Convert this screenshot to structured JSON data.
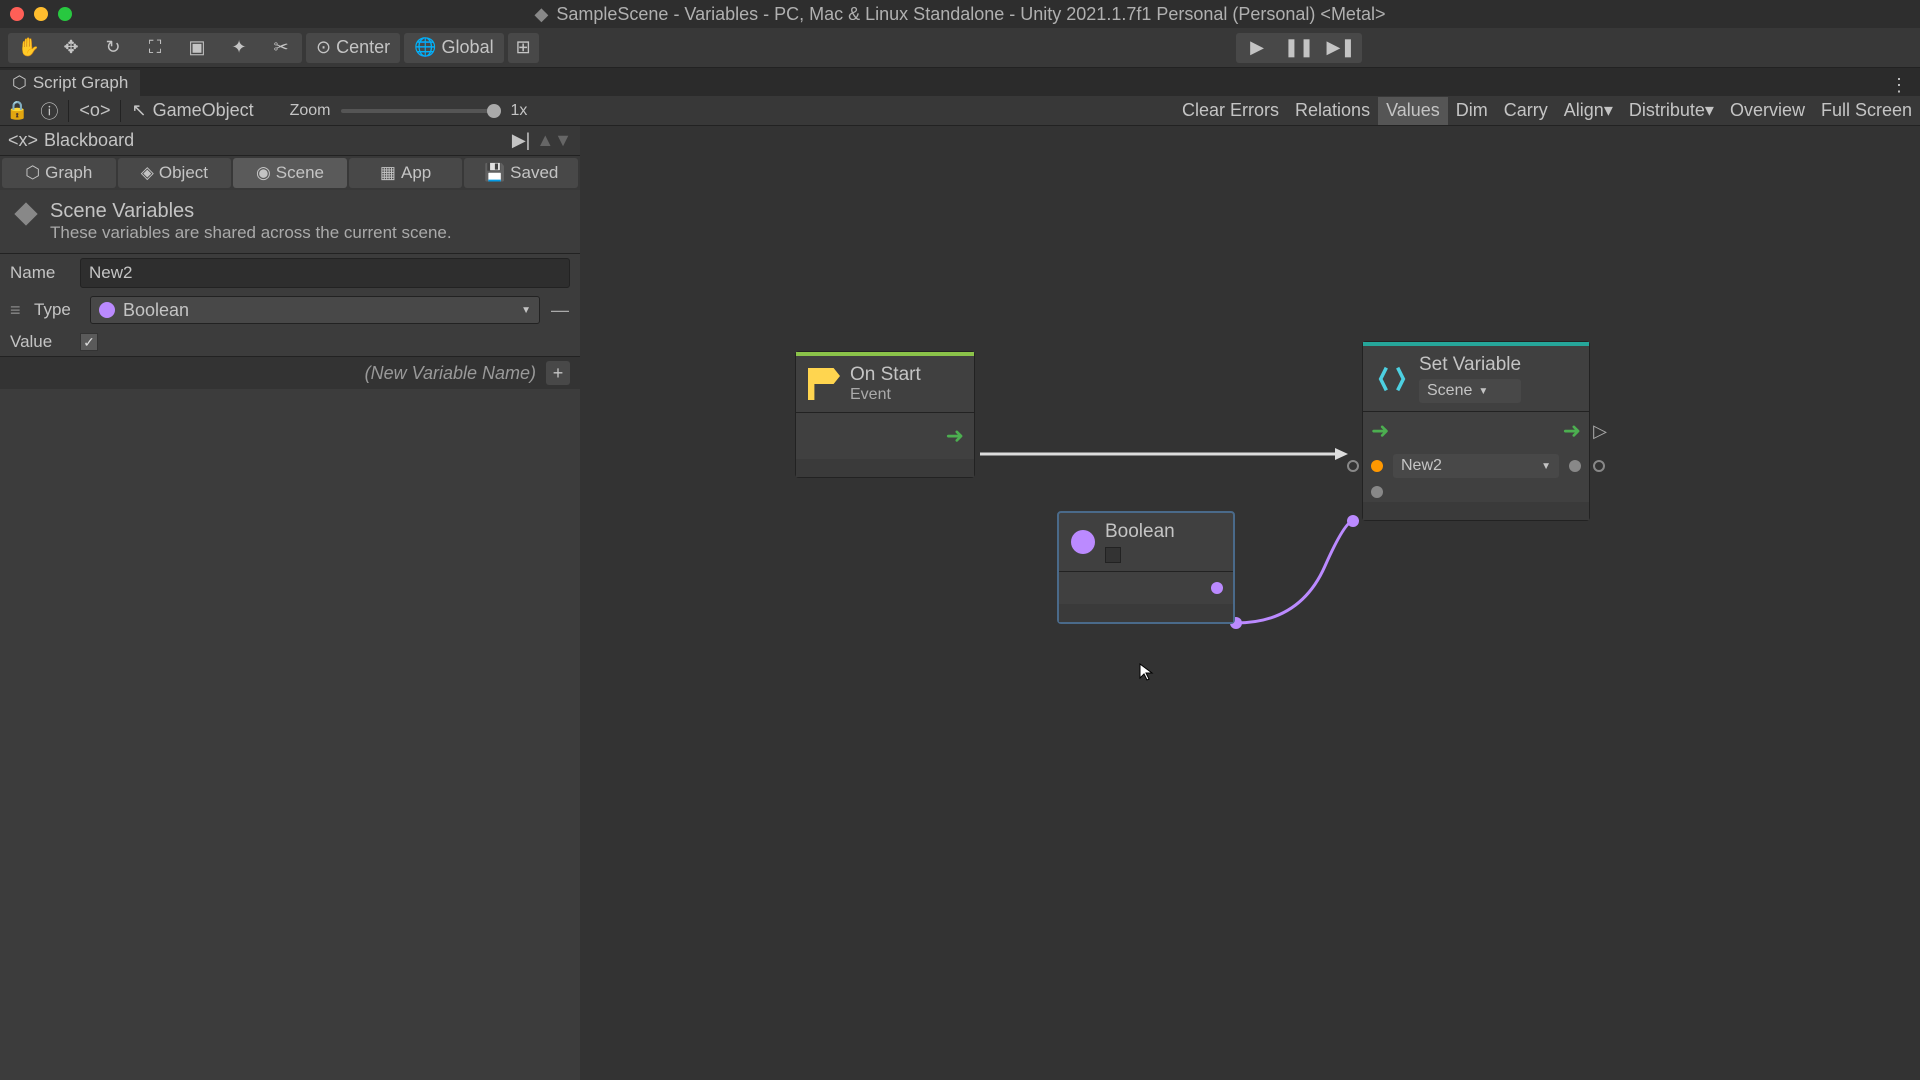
{
  "titlebar": "SampleScene - Variables - PC, Mac & Linux Standalone - Unity 2021.1.7f1 Personal (Personal) <Metal>",
  "toolbar": {
    "pivot": "Center",
    "handle": "Global"
  },
  "tab": "Script Graph",
  "graph_toolbar": {
    "gameobject": "GameObject",
    "zoom_label": "Zoom",
    "zoom_value": "1x",
    "right_buttons": [
      "Clear Errors",
      "Relations",
      "Values",
      "Dim",
      "Carry",
      "Align",
      "Distribute",
      "Overview",
      "Full Screen"
    ]
  },
  "blackboard": {
    "title": "Blackboard",
    "scopes": [
      "Graph",
      "Object",
      "Scene",
      "App",
      "Saved"
    ],
    "scene_vars_title": "Scene Variables",
    "scene_vars_sub": "These variables are shared across the current scene.",
    "name_label": "Name",
    "name_value": "New2",
    "type_label": "Type",
    "type_value": "Boolean",
    "value_label": "Value",
    "value_checked": true,
    "new_var_placeholder": "(New Variable Name)"
  },
  "nodes": {
    "onstart": {
      "title": "On Start",
      "sub": "Event"
    },
    "setvar": {
      "title": "Set Variable",
      "scope": "Scene",
      "var": "New2"
    },
    "boolean": {
      "title": "Boolean"
    }
  }
}
